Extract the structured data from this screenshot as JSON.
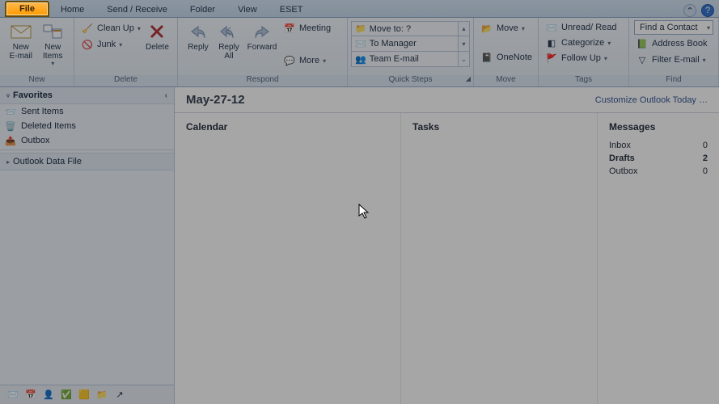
{
  "tabs": [
    "File",
    "Home",
    "Send / Receive",
    "Folder",
    "View",
    "ESET"
  ],
  "ribbon": {
    "new": {
      "group": "New",
      "new_email": "New\nE-mail",
      "new_items": "New\nItems"
    },
    "delete": {
      "group": "Delete",
      "clean_up": "Clean Up",
      "junk": "Junk",
      "delete": "Delete"
    },
    "respond": {
      "group": "Respond",
      "reply": "Reply",
      "reply_all": "Reply\nAll",
      "forward": "Forward",
      "meeting": "Meeting",
      "more": "More"
    },
    "quick_steps": {
      "group": "Quick Steps",
      "items": [
        "Move to: ?",
        "To Manager",
        "Team E-mail"
      ]
    },
    "move": {
      "group": "Move",
      "move": "Move",
      "onenote": "OneNote"
    },
    "tags": {
      "group": "Tags",
      "unread_read": "Unread/ Read",
      "categorize": "Categorize",
      "follow_up": "Follow Up"
    },
    "find": {
      "group": "Find",
      "find_contact": "Find a Contact",
      "address_book": "Address Book",
      "filter_email": "Filter E-mail"
    }
  },
  "nav": {
    "favorites": {
      "title": "Favorites",
      "items": [
        "Sent Items",
        "Deleted Items",
        "Outbox"
      ]
    },
    "data_file": "Outlook Data File"
  },
  "main": {
    "date": "May-27-12",
    "customize": "Customize Outlook Today …",
    "panels": {
      "calendar": {
        "title": "Calendar"
      },
      "tasks": {
        "title": "Tasks"
      },
      "messages": {
        "title": "Messages",
        "rows": [
          {
            "k": "Inbox",
            "v": "0"
          },
          {
            "k": "Drafts",
            "v": "2"
          },
          {
            "k": "Outbox",
            "v": "0"
          }
        ]
      }
    }
  }
}
